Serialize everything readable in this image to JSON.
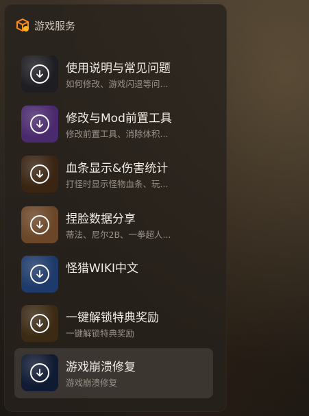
{
  "header": {
    "title": "游戏服务",
    "icon": "package-icon",
    "accent": "#ff8a1e"
  },
  "items": [
    {
      "name": "使用说明与常见问题",
      "desc": "如何修改、游戏闪退等问...",
      "icon": "download-icon",
      "thumb_color": "#1d1d22",
      "active": false
    },
    {
      "name": "修改与Mod前置工具",
      "desc": "修改前置工具、消除体积...",
      "icon": "download-icon",
      "thumb_color": "#4a2a6e",
      "active": false
    },
    {
      "name": "血条显示&伤害统计",
      "desc": "打怪时显示怪物血条、玩...",
      "icon": "download-icon",
      "thumb_color": "#3a2412",
      "active": false
    },
    {
      "name": "捏脸数据分享",
      "desc": "蒂法、尼尔2B、一拳超人...",
      "icon": "download-icon",
      "thumb_color": "#6b4628",
      "active": false
    },
    {
      "name": "怪猎WIKI中文",
      "desc": "",
      "icon": "download-icon",
      "thumb_color": "#1e3a6a",
      "active": false
    },
    {
      "name": "一键解锁特典奖励",
      "desc": "一键解锁特典奖励",
      "icon": "download-icon",
      "thumb_color": "#3b2a14",
      "active": false
    },
    {
      "name": "游戏崩溃修复",
      "desc": "游戏崩溃修复",
      "icon": "download-icon",
      "thumb_color": "#0f1a33",
      "active": true
    }
  ]
}
